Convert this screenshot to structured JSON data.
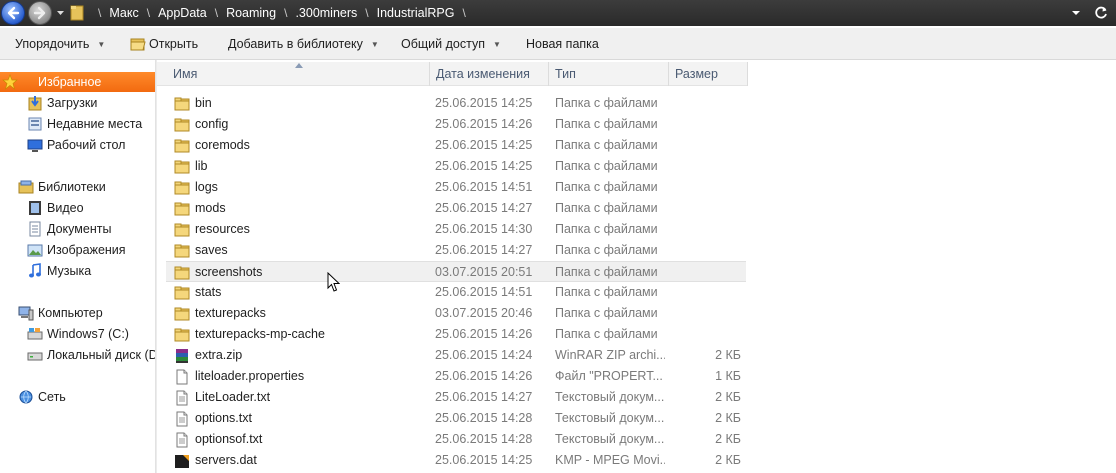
{
  "address": {
    "crumbs": [
      "Макс",
      "AppData",
      "Roaming",
      ".300miners",
      "IndustrialRPG"
    ]
  },
  "toolbar": {
    "organize": "Упорядочить",
    "open": "Открыть",
    "add_to_library": "Добавить в библиотеку",
    "share": "Общий доступ",
    "new_folder": "Новая папка"
  },
  "nav": {
    "favorites": "Избранное",
    "downloads": "Загрузки",
    "recent": "Недавние места",
    "desktop": "Рабочий стол",
    "libraries": "Библиотеки",
    "video": "Видео",
    "documents": "Документы",
    "images": "Изображения",
    "music": "Музыка",
    "computer": "Компьютер",
    "drive_c": "Windows7 (C:)",
    "drive_d": "Локальный диск (D:)",
    "network": "Сеть"
  },
  "columns": {
    "name": "Имя",
    "date": "Дата изменения",
    "type": "Тип",
    "size": "Размер"
  },
  "files": [
    {
      "name": "bin",
      "date": "25.06.2015 14:25",
      "type": "Папка с файлами",
      "size": "",
      "icon": "folder"
    },
    {
      "name": "config",
      "date": "25.06.2015 14:26",
      "type": "Папка с файлами",
      "size": "",
      "icon": "folder"
    },
    {
      "name": "coremods",
      "date": "25.06.2015 14:25",
      "type": "Папка с файлами",
      "size": "",
      "icon": "folder"
    },
    {
      "name": "lib",
      "date": "25.06.2015 14:25",
      "type": "Папка с файлами",
      "size": "",
      "icon": "folder"
    },
    {
      "name": "logs",
      "date": "25.06.2015 14:51",
      "type": "Папка с файлами",
      "size": "",
      "icon": "folder"
    },
    {
      "name": "mods",
      "date": "25.06.2015 14:27",
      "type": "Папка с файлами",
      "size": "",
      "icon": "folder"
    },
    {
      "name": "resources",
      "date": "25.06.2015 14:30",
      "type": "Папка с файлами",
      "size": "",
      "icon": "folder"
    },
    {
      "name": "saves",
      "date": "25.06.2015 14:27",
      "type": "Папка с файлами",
      "size": "",
      "icon": "folder"
    },
    {
      "name": "screenshots",
      "date": "03.07.2015 20:51",
      "type": "Папка с файлами",
      "size": "",
      "icon": "folder"
    },
    {
      "name": "stats",
      "date": "25.06.2015 14:51",
      "type": "Папка с файлами",
      "size": "",
      "icon": "folder"
    },
    {
      "name": "texturepacks",
      "date": "03.07.2015 20:46",
      "type": "Папка с файлами",
      "size": "",
      "icon": "folder"
    },
    {
      "name": "texturepacks-mp-cache",
      "date": "25.06.2015 14:26",
      "type": "Папка с файлами",
      "size": "",
      "icon": "folder"
    },
    {
      "name": "extra.zip",
      "date": "25.06.2015 14:24",
      "type": "WinRAR ZIP archi...",
      "size": "2 КБ",
      "icon": "winrar-archive"
    },
    {
      "name": "liteloader.properties",
      "date": "25.06.2015 14:26",
      "type": "Файл \"PROPERT...",
      "size": "1 КБ",
      "icon": "document"
    },
    {
      "name": "LiteLoader.txt",
      "date": "25.06.2015 14:27",
      "type": "Текстовый докум...",
      "size": "2 КБ",
      "icon": "text-document"
    },
    {
      "name": "options.txt",
      "date": "25.06.2015 14:28",
      "type": "Текстовый докум...",
      "size": "2 КБ",
      "icon": "text-document"
    },
    {
      "name": "optionsof.txt",
      "date": "25.06.2015 14:28",
      "type": "Текстовый докум...",
      "size": "2 КБ",
      "icon": "text-document"
    },
    {
      "name": "servers.dat",
      "date": "25.06.2015 14:25",
      "type": "KMP - MPEG Movi...",
      "size": "2 КБ",
      "icon": "dat-file"
    }
  ],
  "hovered_row": "screenshots"
}
